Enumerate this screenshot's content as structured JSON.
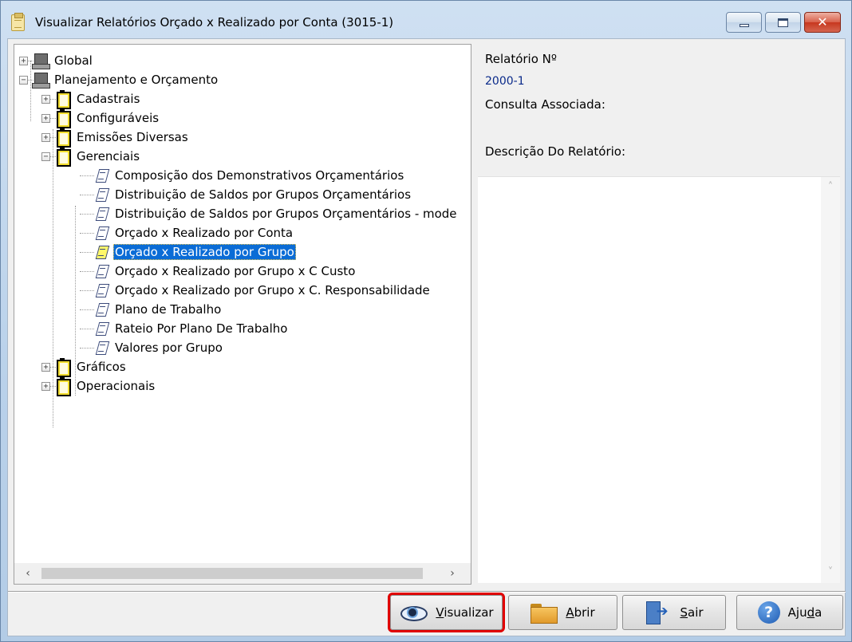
{
  "window": {
    "title": "Visualizar Relatórios Orçado x Realizado por Conta (3015-1)",
    "minimize_glyph": "",
    "maximize_glyph": "",
    "close_glyph": "✕"
  },
  "tree": {
    "nodes": [
      {
        "label": "Global",
        "icon": "computer-icon",
        "expander": "+"
      },
      {
        "label": "Planejamento e Orçamento",
        "icon": "computer-icon",
        "expander": "−"
      },
      {
        "label": "Cadastrais",
        "icon": "clipboard-icon",
        "expander": "+"
      },
      {
        "label": "Configuráveis",
        "icon": "clipboard-icon",
        "expander": "+"
      },
      {
        "label": "Emissões Diversas",
        "icon": "clipboard-icon",
        "expander": "+"
      },
      {
        "label": "Gerenciais",
        "icon": "clipboard-icon",
        "expander": "−"
      },
      {
        "label": "Composição dos Demonstrativos Orçamentários",
        "icon": "report-icon"
      },
      {
        "label": "Distribuição de Saldos por Grupos Orçamentários",
        "icon": "report-icon"
      },
      {
        "label": "Distribuição de Saldos por Grupos Orçamentários - mode",
        "icon": "report-icon"
      },
      {
        "label": "Orçado x Realizado por Conta",
        "icon": "report-icon"
      },
      {
        "label": "Orçado x Realizado por Grupo",
        "icon": "report-icon",
        "selected": true
      },
      {
        "label": "Orçado x Realizado por Grupo x C Custo",
        "icon": "report-icon"
      },
      {
        "label": "Orçado x Realizado por Grupo x C. Responsabilidade",
        "icon": "report-icon"
      },
      {
        "label": "Plano de Trabalho",
        "icon": "report-icon"
      },
      {
        "label": "Rateio Por Plano De Trabalho",
        "icon": "report-icon"
      },
      {
        "label": "Valores por Grupo",
        "icon": "report-icon"
      },
      {
        "label": "Gráficos",
        "icon": "clipboard-icon",
        "expander": "+"
      },
      {
        "label": "Operacionais",
        "icon": "clipboard-icon",
        "expander": "+"
      }
    ],
    "scroll_left": "‹",
    "scroll_right": "›"
  },
  "info": {
    "report_no_label": "Relatório Nº",
    "report_no_value": "2000-1",
    "query_label": "Consulta Associada:",
    "description_label": "Descrição Do Relatório:",
    "scroll_up": "˄",
    "scroll_down": "˅"
  },
  "buttons": {
    "visualizar": {
      "underline": "V",
      "rest": "isualizar"
    },
    "abrir": {
      "underline": "A",
      "rest": "brir"
    },
    "sair": {
      "underline": "S",
      "rest": "air"
    },
    "ajuda": {
      "pre": "Aju",
      "underline": "d",
      "rest": "a"
    }
  },
  "colors": {
    "selection": "#0a6cd6",
    "focus_outline": "#e00000",
    "report_number": "#0a2a8a"
  }
}
